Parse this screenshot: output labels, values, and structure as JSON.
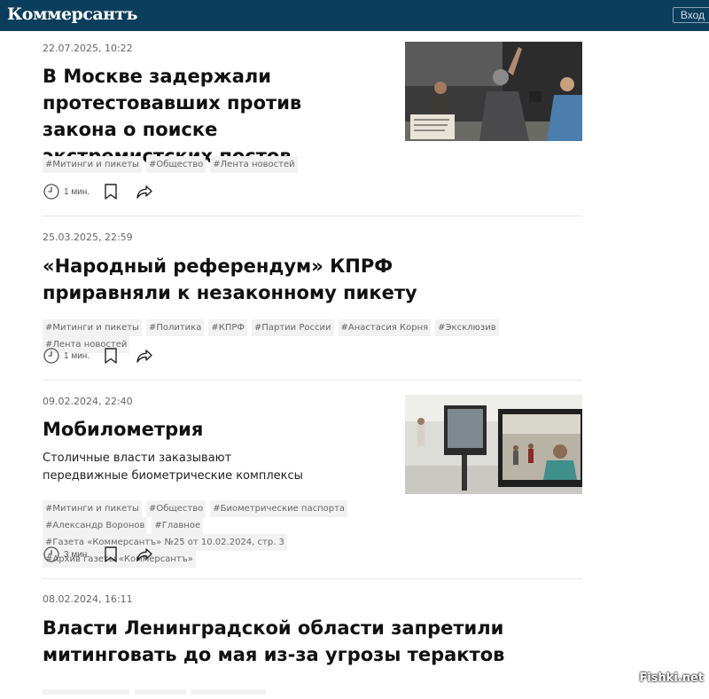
{
  "header": {
    "logo": "Коммерсантъ",
    "login": "Вход"
  },
  "articles": [
    {
      "date": "22.07.2025, 10:22",
      "title": "В Москве задержали протестовавших против закона о поиске экстремистских постов",
      "tags": [
        "#Митинги и пикеты",
        "#Общество",
        "#Лента новостей"
      ],
      "readtime": "1 мин."
    },
    {
      "date": "25.03.2025, 22:59",
      "title": "«Народный референдум» КПРФ приравняли к незаконному пикету",
      "tags": [
        "#Митинги и пикеты",
        "#Политика",
        "#КПРФ",
        "#Партии России",
        "#Анастасия Корня",
        "#Эксклюзив",
        "#Лента новостей"
      ],
      "readtime": "1 мин."
    },
    {
      "date": "09.02.2024, 22:40",
      "title": "Мобилометрия",
      "lead": "Столичные власти заказывают передвижные биометрические комплексы",
      "tags": [
        "#Митинги и пикеты",
        "#Общество",
        "#Биометрические паспорта",
        "#Александр Воронов",
        "#Главное",
        "#Газета «Коммерсантъ» №25 от 10.02.2024, стр. 3",
        "#Архив газеты «Коммерсантъ»"
      ],
      "readtime": "3 мин."
    },
    {
      "date": "08.02.2024, 16:11",
      "title": "Власти Ленинградской области запретили митинговать до мая из-за угрозы терактов"
    }
  ],
  "watermark": "Fishki.net",
  "colors": {
    "header_bg": "#0b3d5c",
    "tag_bg": "#f2f2f2"
  },
  "icons": [
    "clock-icon",
    "bookmark-icon",
    "share-icon"
  ]
}
